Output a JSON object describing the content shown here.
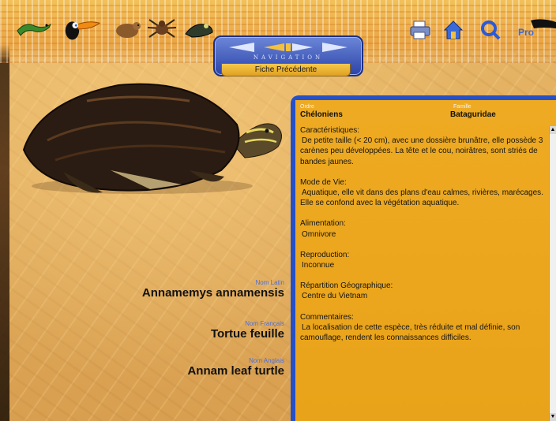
{
  "toolbar": {
    "animals": [
      "lizard-icon",
      "toucan-icon",
      "rodent-icon",
      "spider-icon",
      "frog-icon"
    ],
    "tools": [
      "printer-icon",
      "home-icon",
      "search-icon"
    ],
    "profile_label": "Pro"
  },
  "navigation": {
    "title": "NAVIGATION",
    "previous_record": "Fiche Précédente"
  },
  "species": {
    "latin_label": "Nom Latin",
    "latin_name": "Annamemys annamensis",
    "french_label": "Nom Français",
    "french_name": "Tortue feuille",
    "english_label": "Nom Anglais",
    "english_name": "Annam leaf turtle"
  },
  "panel": {
    "order_label": "Ordre",
    "order_value": "Chéloniens",
    "family_label": "Famille",
    "family_value": "Bataguridae",
    "sections": [
      {
        "title": "Caractéristiques:",
        "text": "De petite taille (< 20 cm), avec une dossière brunâtre, elle possède 3 carènes peu développées. La tête et le cou, noirâtres, sont striés de bandes jaunes."
      },
      {
        "title": "Mode de Vie:",
        "text": "Aquatique, elle vit dans des plans d'eau calmes, rivières, marécages. Elle se confond avec la végétation aquatique."
      },
      {
        "title": "Alimentation:",
        "text": "Omnivore"
      },
      {
        "title": "Reproduction:",
        "text": "Inconnue"
      },
      {
        "title": "Répartition Géographique:",
        "text": "Centre du Vietnam"
      },
      {
        "title": "Commentaires:",
        "text": "La localisation de cette espèce, très réduite et mal définie, son camouflage, rendent les connaissances difficiles."
      }
    ]
  },
  "colors": {
    "panel_border": "#2550c8",
    "panel_bg": "#eeaa22",
    "label_blue": "#4d6fd8"
  }
}
